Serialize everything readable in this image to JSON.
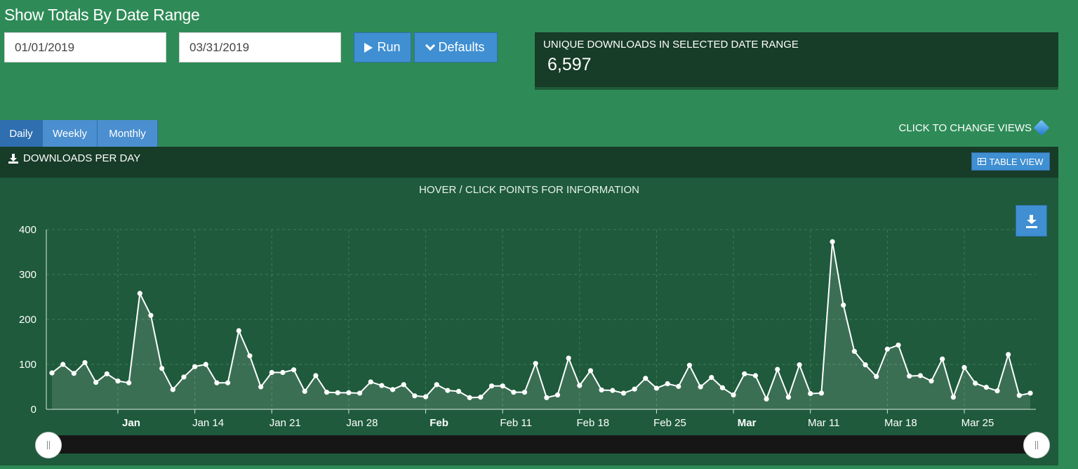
{
  "page": {
    "title": "Show Totals By Date Range"
  },
  "filters": {
    "start_date": "01/01/2019",
    "end_date": "03/31/2019",
    "run_label": "Run",
    "defaults_label": "Defaults"
  },
  "stat": {
    "label": "UNIQUE DOWNLOADS IN SELECTED DATE RANGE",
    "value": "6,597"
  },
  "tabs": [
    {
      "label": "Daily",
      "active": true
    },
    {
      "label": "Weekly",
      "active": false
    },
    {
      "label": "Monthly",
      "active": false
    }
  ],
  "change_views_label": "CLICK TO CHANGE VIEWS",
  "chart_panel": {
    "title": "DOWNLOADS PER DAY",
    "table_view_label": "TABLE VIEW",
    "subtitle": "HOVER / CLICK POINTS FOR INFORMATION"
  },
  "colors": {
    "page_bg": "#2e8b57",
    "panel_dark": "#173c28",
    "chart_bg": "#1e5a3b",
    "button_blue": "#3f8fd2",
    "line": "#ffffff"
  },
  "chart_data": {
    "type": "area",
    "title": "",
    "xlabel": "",
    "ylabel": "",
    "ylim": [
      0,
      400
    ],
    "yticks": [
      0,
      100,
      200,
      300,
      400
    ],
    "grid": true,
    "x_start_date": "2019-01-01",
    "x_end_date": "2019-03-31",
    "xticks": [
      {
        "label": "Jan",
        "date": "2019-01-07",
        "bold": true
      },
      {
        "label": "Jan 14",
        "date": "2019-01-14",
        "bold": false
      },
      {
        "label": "Jan 21",
        "date": "2019-01-21",
        "bold": false
      },
      {
        "label": "Jan 28",
        "date": "2019-01-28",
        "bold": false
      },
      {
        "label": "Feb",
        "date": "2019-02-04",
        "bold": true
      },
      {
        "label": "Feb 11",
        "date": "2019-02-11",
        "bold": false
      },
      {
        "label": "Feb 18",
        "date": "2019-02-18",
        "bold": false
      },
      {
        "label": "Feb 25",
        "date": "2019-02-25",
        "bold": false
      },
      {
        "label": "Mar",
        "date": "2019-03-04",
        "bold": true
      },
      {
        "label": "Mar 11",
        "date": "2019-03-11",
        "bold": false
      },
      {
        "label": "Mar 18",
        "date": "2019-03-18",
        "bold": false
      },
      {
        "label": "Mar 25",
        "date": "2019-03-25",
        "bold": false
      }
    ],
    "series": [
      {
        "name": "",
        "values": [
          81,
          100,
          80,
          104,
          60,
          79,
          63,
          59,
          258,
          209,
          91,
          44,
          72,
          95,
          100,
          59,
          59,
          175,
          119,
          50,
          82,
          82,
          88,
          40,
          75,
          38,
          37,
          37,
          36,
          61,
          53,
          44,
          55,
          30,
          28,
          55,
          42,
          40,
          26,
          27,
          52,
          52,
          38,
          38,
          102,
          26,
          32,
          114,
          53,
          86,
          43,
          42,
          36,
          45,
          69,
          47,
          57,
          51,
          98,
          50,
          71,
          48,
          32,
          79,
          75,
          23,
          89,
          27,
          99,
          35,
          36,
          373,
          232,
          129,
          99,
          73,
          134,
          143,
          74,
          75,
          63,
          112,
          27,
          93,
          58,
          49,
          41,
          122,
          31,
          36
        ]
      }
    ]
  }
}
